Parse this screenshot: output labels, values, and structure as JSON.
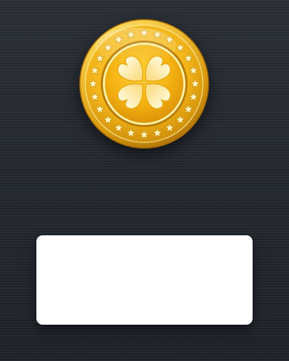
{
  "scene": {
    "background_style": "brushed-dark-metal",
    "colors": {
      "background": "#22272d",
      "coin_gold": "#f2b418",
      "coin_rim_light": "#ffe79a",
      "coin_dark": "#b87a08",
      "panel_background": "#ffffff"
    }
  },
  "coin": {
    "icon": "clover-coin-icon",
    "emblem": "four-leaf-clover",
    "border_decoration": "stars"
  },
  "panel": {
    "text": ""
  }
}
